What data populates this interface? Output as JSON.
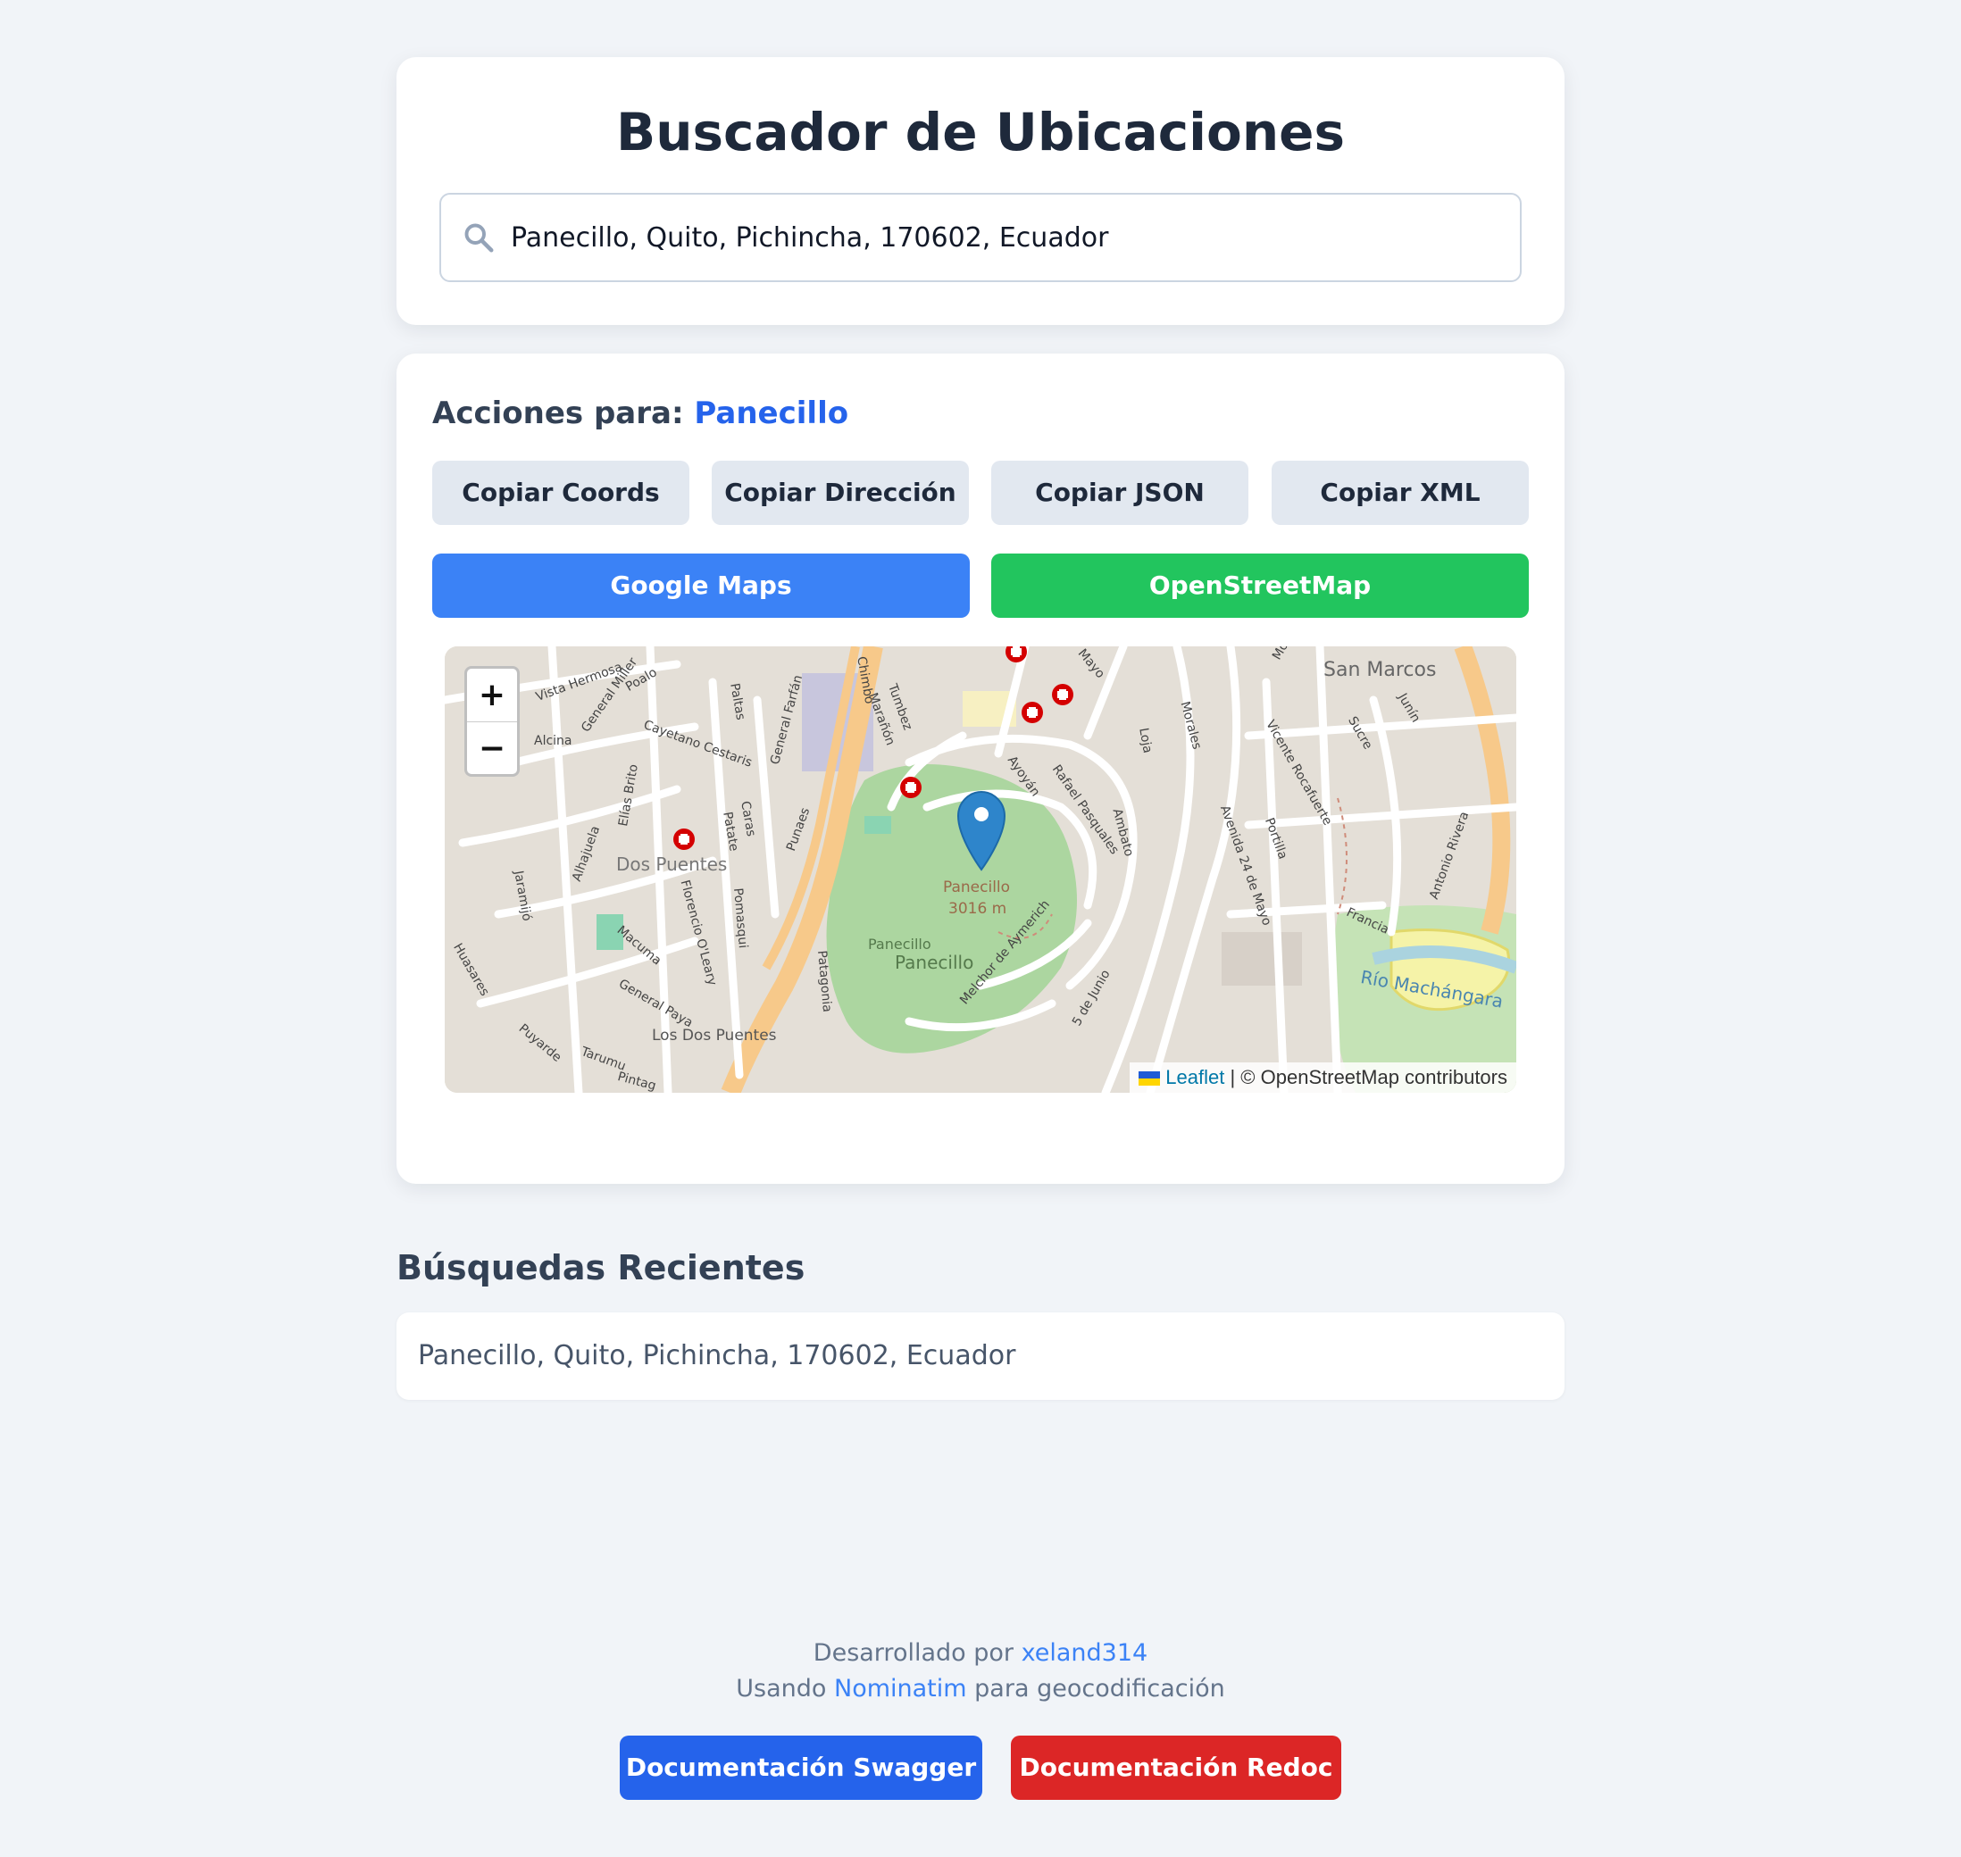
{
  "header": {
    "title": "Buscador de Ubicaciones"
  },
  "search": {
    "value": "Panecillo, Quito, Pichincha, 170602, Ecuador",
    "icon": "search-icon"
  },
  "actions": {
    "heading_prefix": "Acciones para:",
    "place_name": "Panecillo",
    "copy_coords": "Copiar Coords",
    "copy_address": "Copiar Dirección",
    "copy_json": "Copiar JSON",
    "copy_xml": "Copiar XML",
    "google_maps": "Google Maps",
    "openstreetmap": "OpenStreetMap"
  },
  "map": {
    "zoom_in": "+",
    "zoom_out": "−",
    "attribution_link": "Leaflet",
    "attribution_text": "| © OpenStreetMap contributors",
    "labels": {
      "san_marcos": "San Marcos",
      "dos_puentes": "Dos Puentes",
      "los_dos_puentes": "Los Dos Puentes",
      "panecillo_peak": "Panecillo",
      "panecillo_elev": "3016 m",
      "panecillo_park_small": "Panecillo",
      "panecillo_park": "Panecillo",
      "rio_machangara": "Río Machángara",
      "vista_hermosa": "Vista Hermosa",
      "poalo": "Poalo",
      "alcina": "Alcina",
      "cayetano_cestaris": "Cayetano Cestaris",
      "general_miller": "General Miller",
      "elias_brito": "Elías Brito",
      "paltas": "Paltas",
      "general_farfan": "General Farfán",
      "chimbo": "Chimbo",
      "tumbez": "Tumbez",
      "maranon": "Marañón",
      "caras": "Caras",
      "patate": "Patate",
      "punaes": "Punaes",
      "ayoyan": "Ayoyán",
      "rafael_pasquales": "Rafael Pasquales",
      "ambato": "Ambato",
      "loja": "Loja",
      "morales": "Morales",
      "montufar": "Montúfar",
      "vicente_rocafuerte": "Vicente Rocafuerte",
      "sucre": "Sucre",
      "junin": "Junín",
      "avenida_24_mayo": "Avenida 24 de Mayo",
      "francia": "Francia",
      "antonio_rivera": "Antonio Rivera",
      "jaramijo": "Jaramijó",
      "alhajuela": "Alhajuela",
      "macuma": "Macuma",
      "general_paya": "General Paya",
      "florencio_oleary": "Florencio O'Leary",
      "pomasqui": "Pomasqui",
      "patagonia": "Patagonia",
      "melchor_aymerich": "Melchor de Aymerich",
      "cinco_junio": "5 de Junio",
      "huasares": "Huasares",
      "puyarde": "Puyarde",
      "tarumu": "Tarumu",
      "pintag": "Pintag",
      "mayo": "Mayo",
      "portilla": "Portilla"
    }
  },
  "recent": {
    "title": "Búsquedas Recientes",
    "items": [
      "Panecillo, Quito, Pichincha, 170602, Ecuador"
    ]
  },
  "footer": {
    "developed_by": "Desarrollado por",
    "developer": "xeland314",
    "using": "Usando",
    "nominatim": "Nominatim",
    "for_geocoding": "para geocodificación",
    "swagger": "Documentación Swagger",
    "redoc": "Documentación Redoc"
  },
  "colors": {
    "accent_blue": "#3b82f6",
    "accent_green": "#22c55e",
    "accent_red": "#dc2626",
    "swagger_blue": "#2563eb"
  }
}
